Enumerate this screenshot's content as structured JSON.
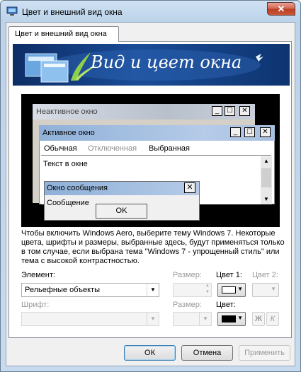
{
  "window": {
    "title": "Цвет и внешний вид окна",
    "close_glyph": "✕"
  },
  "tab": {
    "label": "Цвет и внешний вид окна"
  },
  "banner": {
    "title": "Вид и цвет окна"
  },
  "preview": {
    "inactive_title": "Неактивное окно",
    "active_title": "Активное окно",
    "menu_normal": "Обычная",
    "menu_disabled": "Отключенная",
    "menu_selected": "Выбранная",
    "window_text": "Текст в окне",
    "message_title": "Окно сообщения",
    "message_text": "Сообщение",
    "message_ok": "OK",
    "caption_buttons": [
      "_",
      "☐",
      "✕"
    ],
    "scroll_up": "▲",
    "scroll_down": "▼"
  },
  "description": "Чтобы включить Windows Aero, выберите тему Windows 7. Некоторые цвета, шрифты и размеры, выбранные здесь, будут применяться только в том случае, если выбрана тема \"Windows 7 - упрощенный стиль\" или тема с высокой контрастностью.",
  "form": {
    "item_label": "Элемент:",
    "item_value": "Рельефные объекты",
    "size1_label": "Размер:",
    "color1_label": "Цвет 1:",
    "color2_label": "Цвет 2:",
    "font_label": "Шрифт:",
    "size2_label": "Размер:",
    "color_label": "Цвет:",
    "bold_label": "Ж",
    "italic_label": "К",
    "color1_value": "#ffffff",
    "color_value": "#000000"
  },
  "buttons": {
    "ok": "ОК",
    "cancel": "Отмена",
    "apply": "Применить"
  }
}
